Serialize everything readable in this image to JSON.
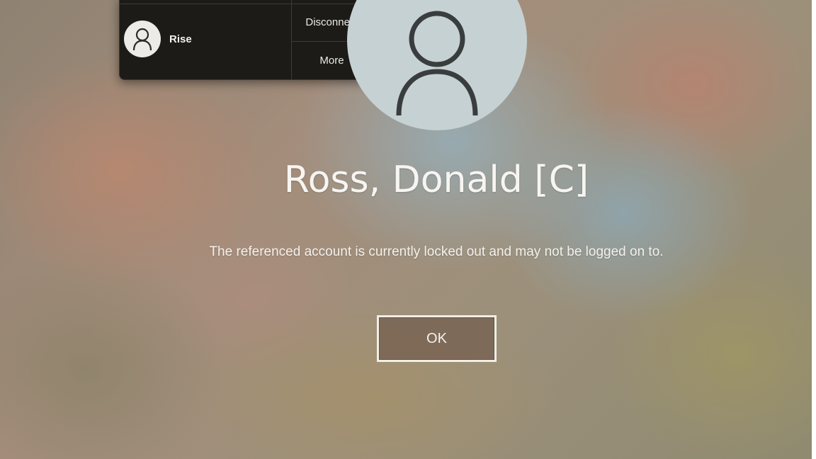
{
  "user_menu": {
    "username": "Rise",
    "disconnect_label": "Disconnect",
    "more_label": "More",
    "icons": {
      "avatar": "person-icon",
      "more": "chevron-down-icon"
    }
  },
  "lock_screen": {
    "user_name": "Ross, Donald [C]",
    "message": "The referenced account is currently locked out and may not be logged on to.",
    "ok_label": "OK",
    "avatar_icon": "person-icon"
  },
  "colors": {
    "panel_background": "#1c1b17",
    "avatar_circle": "#c6d1d3",
    "text": "#f7f5f2"
  }
}
